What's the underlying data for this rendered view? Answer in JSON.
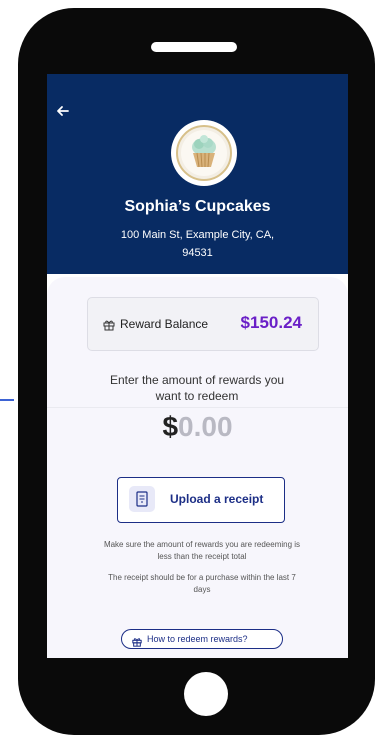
{
  "store": {
    "name": "Sophia’s Cupcakes",
    "address": "100 Main St, Example City, CA, 94531"
  },
  "balance": {
    "label": "Reward Balance",
    "value": "$150.24"
  },
  "prompt": "Enter the amount of rewards you want to redeem",
  "amount": {
    "currency": "$",
    "value": "0.00"
  },
  "upload": {
    "label": "Upload a receipt"
  },
  "notes": [
    "Make sure the amount of rewards you are redeeming is less than the receipt total",
    "The receipt should be for a purchase within the last 7 days"
  ],
  "help_link": "How to redeem rewards?",
  "icons": {
    "back": "back-arrow-icon",
    "gift": "gift-icon",
    "receipt": "receipt-icon",
    "avatar": "cupcake-logo"
  },
  "colors": {
    "header": "#082b63",
    "accent": "#1c2e86",
    "balance": "#6a1fc7"
  }
}
